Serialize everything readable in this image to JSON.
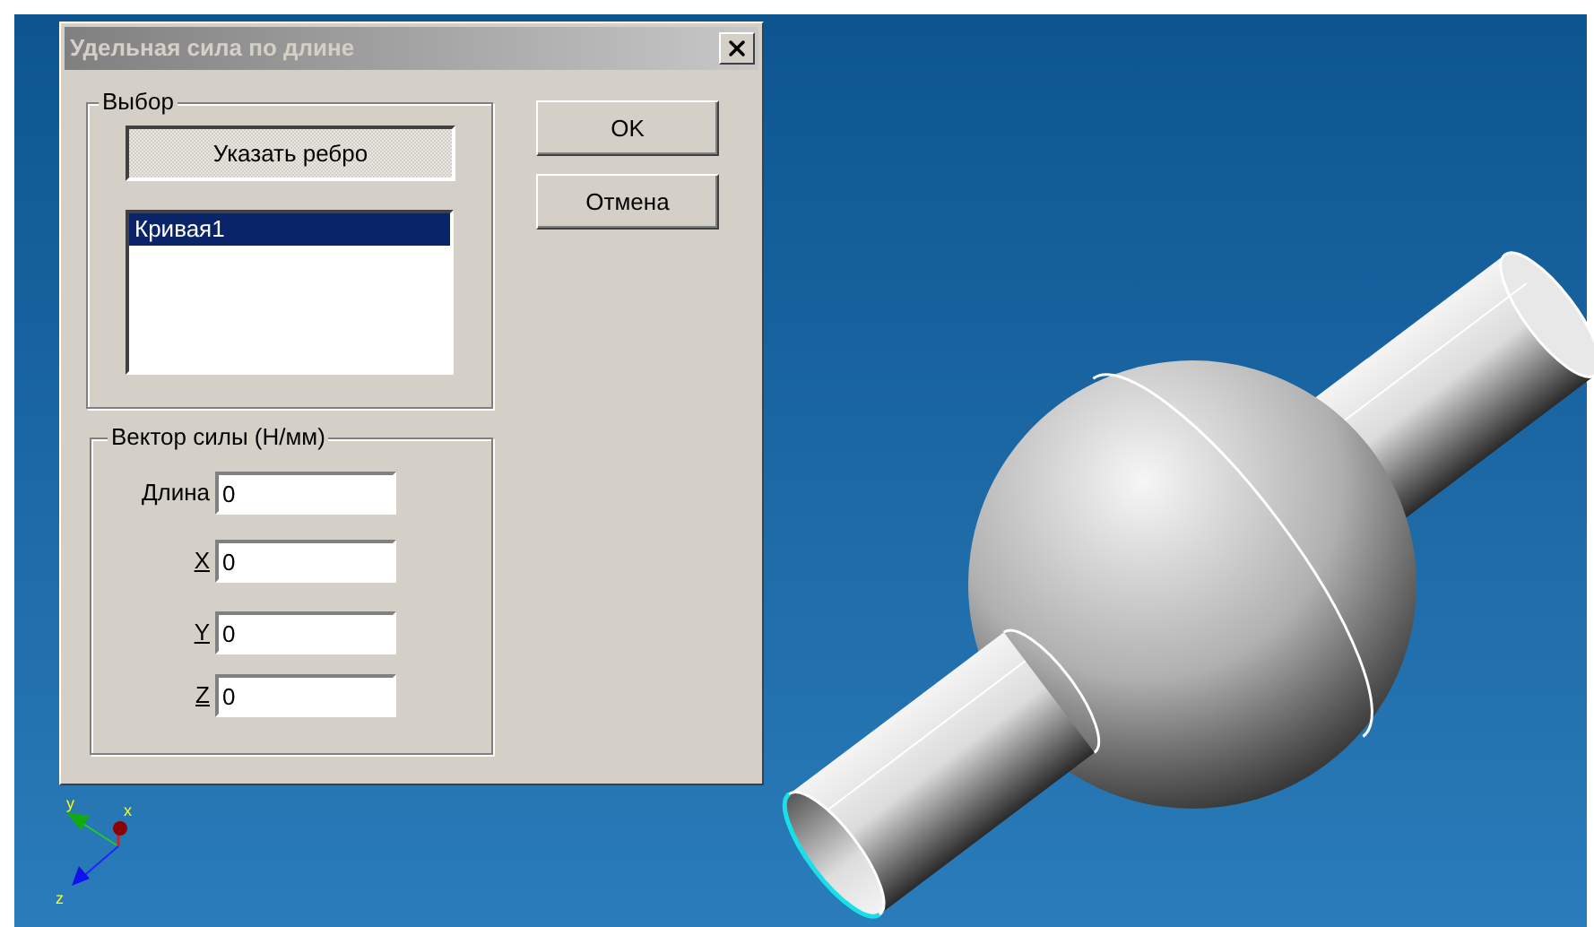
{
  "dialog": {
    "title": "Удельная сила по длине",
    "selection_group": {
      "label": "Выбор",
      "pick_button": "Указать ребро",
      "list": [
        {
          "label": "Кривая1",
          "selected": true
        }
      ]
    },
    "buttons": [
      "OK",
      "Отмена"
    ],
    "force_group": {
      "label": "Вектор силы (Н/мм)",
      "fields": [
        {
          "kind": "length",
          "label": "Длина",
          "value": "0"
        },
        {
          "kind": "axis",
          "label": "X",
          "value": "0"
        },
        {
          "kind": "axis",
          "label": "Y",
          "value": "0"
        },
        {
          "kind": "axis",
          "label": "Z",
          "value": "0"
        }
      ]
    }
  },
  "axis_triad": {
    "x": "x",
    "y": "y",
    "z": "z"
  }
}
